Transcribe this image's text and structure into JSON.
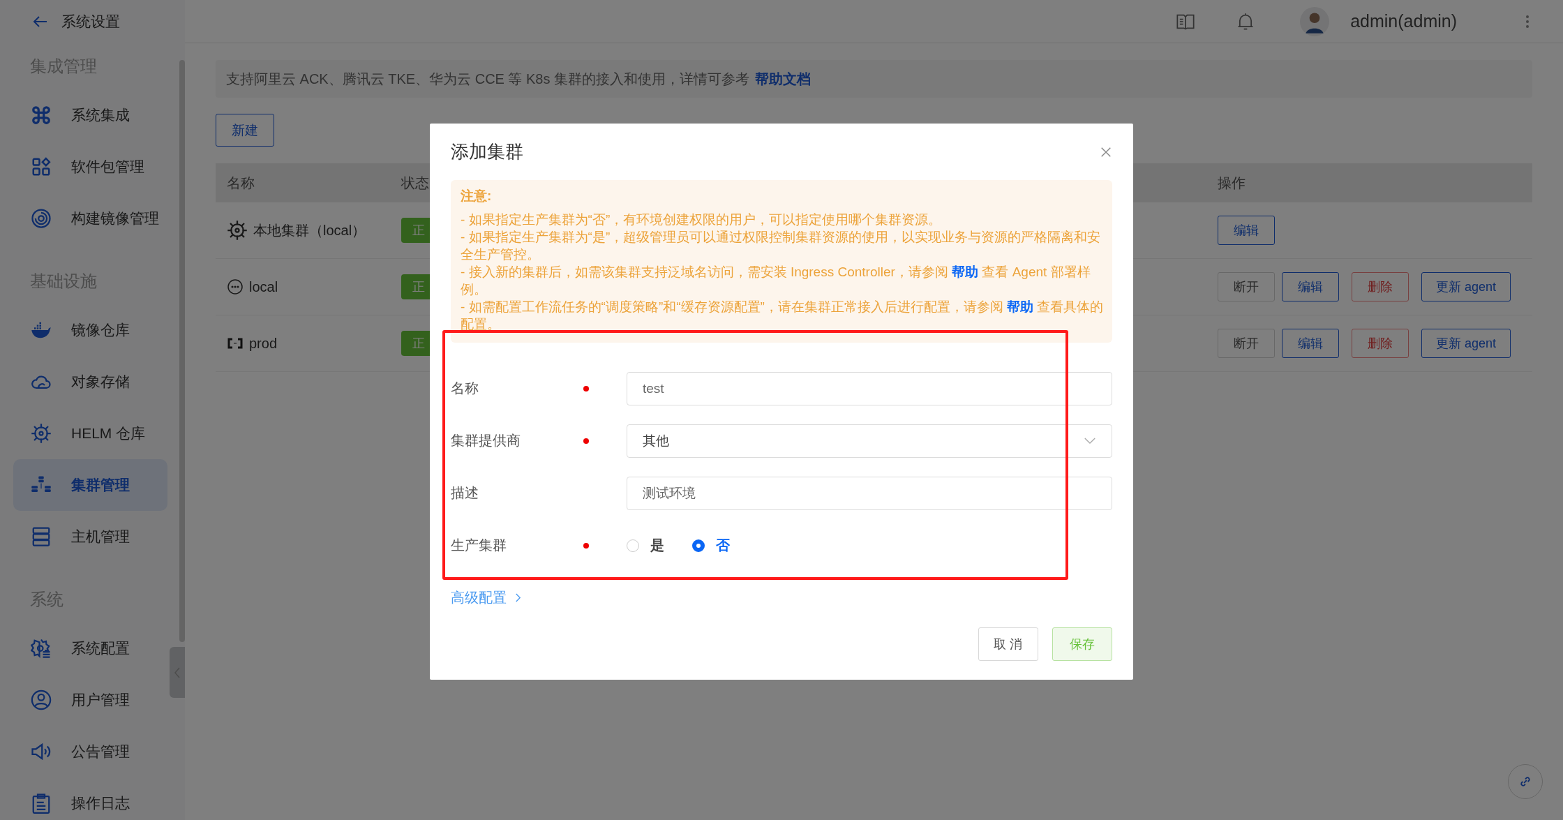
{
  "header": {
    "back_title": "系统设置",
    "user": "admin(admin)"
  },
  "sidebar": {
    "sections": [
      {
        "title": "集成管理",
        "items": [
          {
            "label": "系统集成",
            "selected": false
          },
          {
            "label": "软件包管理",
            "selected": false
          },
          {
            "label": "构建镜像管理",
            "selected": false
          }
        ]
      },
      {
        "title": "基础设施",
        "items": [
          {
            "label": "镜像仓库",
            "selected": false
          },
          {
            "label": "对象存储",
            "selected": false
          },
          {
            "label": "HELM 仓库",
            "selected": false
          },
          {
            "label": "集群管理",
            "selected": true
          },
          {
            "label": "主机管理",
            "selected": false
          }
        ]
      },
      {
        "title": "系统",
        "items": [
          {
            "label": "系统配置",
            "selected": false
          },
          {
            "label": "用户管理",
            "selected": false
          },
          {
            "label": "公告管理",
            "selected": false
          },
          {
            "label": "操作日志",
            "selected": false
          }
        ]
      }
    ]
  },
  "banner": {
    "text": "支持阿里云 ACK、腾讯云 TKE、华为云 CCE 等 K8s 集群的接入和使用，详情可参考",
    "link": "帮助文档"
  },
  "new_button": "新建",
  "table": {
    "columns": [
      "名称",
      "状态",
      "操作"
    ],
    "rows": [
      {
        "name": "本地集群（local）",
        "status": "正",
        "actions": [
          {
            "label": "编辑",
            "kind": "primary"
          }
        ]
      },
      {
        "name": "local",
        "status": "正",
        "actions": [
          {
            "label": "断开",
            "kind": "default"
          },
          {
            "label": "编辑",
            "kind": "primary"
          },
          {
            "label": "删除",
            "kind": "danger"
          },
          {
            "label": "更新 agent",
            "kind": "primary"
          }
        ]
      },
      {
        "name": "prod",
        "status": "正",
        "actions": [
          {
            "label": "断开",
            "kind": "default"
          },
          {
            "label": "编辑",
            "kind": "primary"
          },
          {
            "label": "删除",
            "kind": "danger"
          },
          {
            "label": "更新 agent",
            "kind": "primary"
          }
        ]
      }
    ]
  },
  "modal": {
    "title": "添加集群",
    "notice": {
      "title": "注意:",
      "items": [
        [
          {
            "text": "- 如果指定生产集群为“否”，有环境创建权限的用户，可以指定使用哪个集群资源。",
            "kind": "text"
          }
        ],
        [
          {
            "text": "- 如果指定生产集群为“是”，超级管理员可以通过权限控制集群资源的使用，以实现业务与资源的严格隔离和安全生产管控。",
            "kind": "text"
          }
        ],
        [
          {
            "text": "- 接入新的集群后，如需该集群支持泛域名访问，需安装 Ingress Controller，请参阅 ",
            "kind": "text"
          },
          {
            "text": "帮助",
            "kind": "link"
          },
          {
            "text": " 查看 Agent 部署样例。",
            "kind": "text"
          }
        ],
        [
          {
            "text": "- 如需配置工作流任务的“调度策略”和“缓存资源配置”，请在集群正常接入后进行配置，请参阅 ",
            "kind": "text"
          },
          {
            "text": "帮助",
            "kind": "link"
          },
          {
            "text": " 查看具体的配置。",
            "kind": "text"
          }
        ]
      ]
    },
    "fields": [
      {
        "label": "名称",
        "required": true,
        "kind": "input",
        "value": "test"
      },
      {
        "label": "集群提供商",
        "required": true,
        "kind": "select",
        "value": "其他"
      },
      {
        "label": "描述",
        "required": false,
        "kind": "input",
        "value": "测试环境"
      },
      {
        "label": "生产集群",
        "required": true,
        "kind": "radio",
        "options": [
          {
            "label": "是",
            "selected": false
          },
          {
            "label": "否",
            "selected": true
          }
        ]
      }
    ],
    "advanced": "高级配置",
    "buttons": [
      {
        "label": "取 消",
        "kind": "default"
      },
      {
        "label": "保存",
        "kind": "success"
      }
    ]
  },
  "annotations": [
    {
      "kind": "rectangle"
    }
  ]
}
